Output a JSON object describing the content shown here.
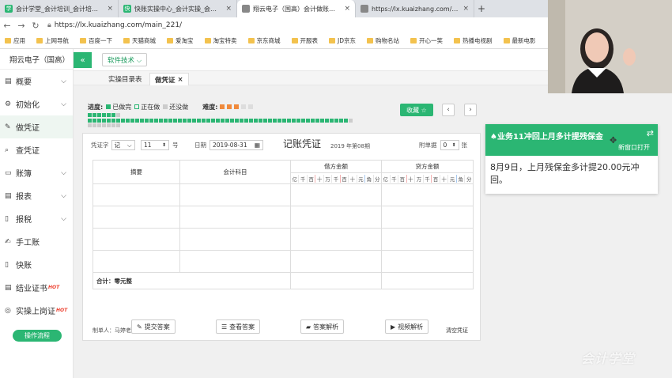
{
  "browser": {
    "tabs": [
      {
        "title": "会计学堂_会计培训_会计培训班_",
        "fav": "学",
        "color": "#2bb673",
        "active": false
      },
      {
        "title": "快账实操中心_会计实操_会计做账",
        "fav": "快",
        "color": "#2bb673",
        "active": false
      },
      {
        "title": "翔云电子（国高）会计做账会计",
        "fav": "",
        "color": "#888888",
        "active": true
      },
      {
        "title": "https://lx.kuaizhang.com/view",
        "fav": "",
        "color": "#888888",
        "active": false
      }
    ],
    "url": "https://lx.kuaizhang.com/main_221/",
    "bookmarks": [
      "应用",
      "上网导航",
      "百度一下",
      "天猫商城",
      "爱淘宝",
      "淘宝特卖",
      "京东商城",
      "开服表",
      "JD京东",
      "购物名站",
      "开心一笑",
      "热播电视剧",
      "最新电影"
    ]
  },
  "sidebar": {
    "company": "翔云电子（国高）",
    "items": [
      {
        "label": "概要",
        "icon": "▤",
        "chevron": true,
        "active": false
      },
      {
        "label": "初始化",
        "icon": "⚙",
        "chevron": true,
        "active": false
      },
      {
        "label": "做凭证",
        "icon": "✎",
        "chevron": false,
        "active": true
      },
      {
        "label": "查凭证",
        "icon": "⌕",
        "chevron": false,
        "active": false
      },
      {
        "label": "账簿",
        "icon": "▭",
        "chevron": true,
        "active": false
      },
      {
        "label": "报表",
        "icon": "▤",
        "chevron": true,
        "active": false
      },
      {
        "label": "报税",
        "icon": "▯",
        "chevron": true,
        "active": false
      },
      {
        "label": "手工账",
        "icon": "✍",
        "chevron": false,
        "active": false
      },
      {
        "label": "快账",
        "icon": "▯",
        "chevron": false,
        "active": false
      },
      {
        "label": "结业证书",
        "icon": "▤",
        "chevron": false,
        "active": false,
        "hot": "HOT"
      },
      {
        "label": "实操上岗证",
        "icon": "◎",
        "chevron": false,
        "active": false,
        "hot": "HOT"
      }
    ],
    "flow_button": "操作流程"
  },
  "topbar": {
    "toggle": "«",
    "software": "软件技术 ⌵"
  },
  "subtabs": [
    {
      "label": "实操目录表",
      "active": false
    },
    {
      "label": "做凭证",
      "active": true,
      "close": "×"
    }
  ],
  "progress": {
    "label": "进度:",
    "done": "已做完",
    "doing": "正在做",
    "todo": "还没做",
    "difficulty": "难度:",
    "rows": [
      {
        "done": 6,
        "doing": 1,
        "todo": 0
      },
      {
        "done": 55,
        "doing": 5,
        "todo": 3
      }
    ]
  },
  "collect_button": "收藏 ☆",
  "pager": {
    "prev": "‹",
    "next": "›"
  },
  "voucher": {
    "word_label": "凭证字",
    "word_value": "记",
    "number": "11",
    "number_label": "号",
    "date_label": "日期",
    "date": "2019-08-31",
    "title": "记账凭证",
    "period": "2019 年第08期",
    "attach_label": "附单据",
    "attach_value": "0",
    "attach_unit": "张",
    "col_summary": "摘要",
    "col_account": "会计科目",
    "col_debit": "借方金额",
    "col_credit": "贷方金额",
    "digits": [
      "亿",
      "千",
      "百",
      "十",
      "万",
      "千",
      "百",
      "十",
      "元",
      "角",
      "分"
    ],
    "total": "合计：零元整",
    "maker": "制单人：马婷老师",
    "clear": "清空凭证"
  },
  "actions": [
    {
      "label": "提交答案",
      "icon": "✎"
    },
    {
      "label": "查看答案",
      "icon": "☰"
    },
    {
      "label": "答案解析",
      "icon": "▰"
    },
    {
      "label": "视频解析",
      "icon": "▶"
    }
  ],
  "task": {
    "title": "♠业务11冲回上月多计提残保金",
    "open": "新窗口打开",
    "swap": "⇄",
    "text": "8月9日，上月残保金多计提20.00元冲回。"
  },
  "watermark": "会计学堂"
}
